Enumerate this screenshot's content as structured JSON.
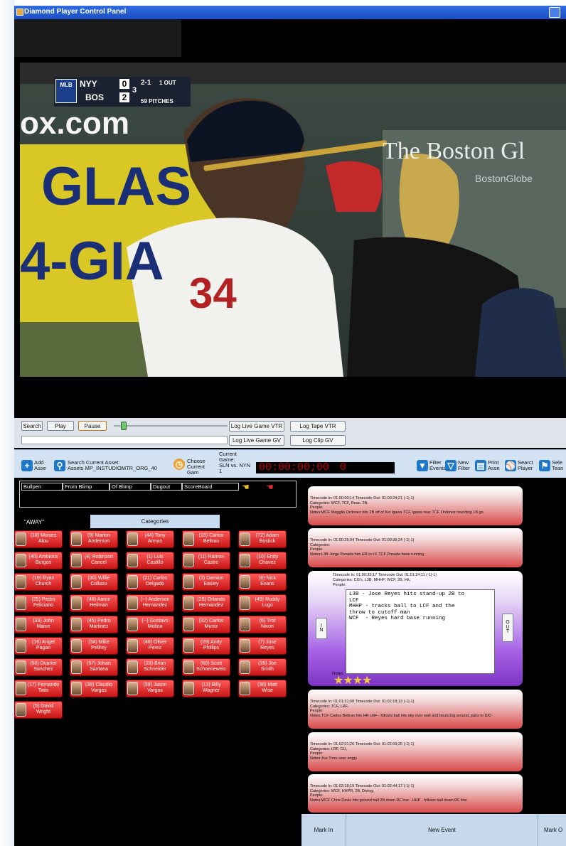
{
  "window": {
    "title": "Diamond Player Control Panel"
  },
  "video": {
    "scorebug": {
      "network": "MLB",
      "away_team": "NYY",
      "away_score": "0",
      "home_team": "BOS",
      "home_score": "2",
      "inning": "3",
      "count": "2-1",
      "outs": "1 OUT",
      "pitches": "59 PITCHES"
    },
    "background_signs": [
      "ox.com",
      "GLAS",
      "4-GIA",
      "The Boston Gl",
      "BostonGlobe"
    ],
    "jersey_number": "34"
  },
  "controls": {
    "search_label": "Search",
    "play_label": "Play",
    "pause_label": "Pause",
    "log_live_vtr": "Log Live Game VTR",
    "log_tape_vtr": "Log Tape VTR",
    "log_live_gv": "Log Live Game GV",
    "log_clip_gv": "Log Clip GV",
    "search_value": ""
  },
  "toolbar": {
    "add_asset": "Add Asse",
    "search_current_asset": "Search Current Asset:",
    "asset_value": "Assets MP_INSTUDIOMTR_ORG_40",
    "choose_current_game": "Choose Current Gam",
    "current_game_label": "Current Game:",
    "current_game_value": "SLN vs. NYN",
    "current_game_num": "1",
    "timecode": "00:00:00;00",
    "timecode_zero": "0",
    "filter_events": "Filter Events",
    "new_filter": "New Filter",
    "print_asset": "Print Asse",
    "search_player": "Searct Player",
    "select_team": "Sele Tean"
  },
  "tabs": [
    "Bullpen",
    "From Blimp",
    "Of Blimp",
    "Dugout",
    "ScoreBoard"
  ],
  "roster": {
    "away_label": "\"AWAY\"",
    "categories_label": "Categories",
    "players": [
      [
        "(18) Moises",
        "Alou"
      ],
      [
        "(9) Marlon",
        "Anderson"
      ],
      [
        "(44) Tony",
        "Armas"
      ],
      [
        "(15) Carlos",
        "Beltran"
      ],
      [
        "(72) Adam",
        "Bostick"
      ],
      [
        "(40) Ambiorix",
        "Burgos"
      ],
      [
        "(4) Robinson",
        "Cancel"
      ],
      [
        "(1) Luis",
        "Castillo"
      ],
      [
        "(11) Ramon",
        "Castro"
      ],
      [
        "(10) Endy",
        "Chavez"
      ],
      [
        "(19) Ryan",
        "Church"
      ],
      [
        "(36) Willie",
        "Collazo"
      ],
      [
        "(21) Carlos",
        "Delgado"
      ],
      [
        "(3) Damion",
        "Easley"
      ],
      [
        "(6) Nick",
        "Evans"
      ],
      [
        "(25) Pedro",
        "Feliciano"
      ],
      [
        "(48) Aaron",
        "Heilman"
      ],
      [
        "(--) Anderson",
        "Hernandez"
      ],
      [
        "(26) Orlando",
        "Hernandez"
      ],
      [
        "(49) Ruddy",
        "Lugo"
      ],
      [
        "(33) John",
        "Maine"
      ],
      [
        "(45) Pedro",
        "Martinez"
      ],
      [
        "(--) Gustavo",
        "Molina"
      ],
      [
        "(32) Carlos",
        "Muniz"
      ],
      [
        "(6) Trot",
        "Nixon"
      ],
      [
        "(16) Angel",
        "Pagan"
      ],
      [
        "(34) Mike",
        "Pelfrey"
      ],
      [
        "(46) Oliver",
        "Perez"
      ],
      [
        "(29) Andy",
        "Phillips"
      ],
      [
        "(7) Jose",
        "Reyes"
      ],
      [
        "(50) Duaner",
        "Sanchez"
      ],
      [
        "(57) Johan",
        "Santana"
      ],
      [
        "(23) Brian",
        "Schneider"
      ],
      [
        "(60) Scott",
        "Schoeneweis"
      ],
      [
        "(35) Joe",
        "Smith"
      ],
      [
        "(17) Fernando",
        "Tatis"
      ],
      [
        "(39) Claudio",
        "Vargas"
      ],
      [
        "(39) Jason",
        "Vargas"
      ],
      [
        "(13) Billy",
        "Wagner"
      ],
      [
        "(38) Matt",
        "Wise"
      ],
      [
        "(5) David",
        "Wright"
      ]
    ]
  },
  "events": [
    {
      "timecode": "Timecode In: 01:00:00;14 Timecode Out: 01:00:24;21 (-1|-1)",
      "categories": "Categories: WCF, TCF, Reac, 2B,",
      "people": "People:",
      "notes": "Notes:WCF Magglio Ordonez hits 2B off of Kei Igawa TCF Igawa reac TCF Ordonez rounding 1B go"
    },
    {
      "timecode": "Timecode In: 01:00:25;04 Timecode Out: 01:00:35;24 (-1|-1)",
      "categories": "Categories:",
      "people": "People:",
      "notes": "Notes:L3B Jorge Posada hits HR to LF TCF Posada base running"
    },
    {
      "timecode": "Timecode In: 01:00:35;17 Timecode Out: 01:01:24;11 (-1|-1)",
      "categories": "Categories: CG's, L3B, MHHP, WCF, 2B, Hit,",
      "people": "People:",
      "editor_lines": [
        "L3B - Jose Reyes hits stand-up 2B to",
        "LCF",
        "MHHP - tracks ball to LCF and the",
        "throw to cutoff man",
        "WCF  - Reyes hard base running"
      ],
      "in_label": "I\nN",
      "out_label": "O\nU\nT",
      "notes_label": "Notes",
      "rating": 4
    },
    {
      "timecode": "Timecode In: 01:01:31;08 Timecode Out: 01:02:18;13 (-1|-1)",
      "categories": "Categories: TCF, LRF,",
      "people": "People:",
      "notes": "Notes:TCF Carlos Beltran hits HR LRF - follows ball into sky over wall and bouncing around, pans to D/O"
    },
    {
      "timecode": "Timecode In: 01:02:01;26 Timecode Out: 01:02:09;25 (-1|-1)",
      "categories": "Categories: LRF, CU,",
      "people": "People:",
      "notes": "Notes:Joe Torre reac angry"
    },
    {
      "timecode": "Timecode In: 01:02:18;19 Timecode Out: 01:02:44;17 (-1|-1)",
      "categories": "Categories: WCF, HHPR, 2B, Diving,",
      "people": "People:",
      "notes": "Notes:WCF Chris Davis hits ground ball 2B down RF line - HHP - follows ball down RF line"
    }
  ],
  "bottom": {
    "mark_in": "Mark In",
    "new_event": "New Event",
    "mark_out": "Mark O"
  },
  "colors": {
    "accent_red": "#e21b1b",
    "timecode_red": "#c00000",
    "toolbar_blue": "#d2e2f3",
    "event_purple": "#8a3fd0"
  }
}
